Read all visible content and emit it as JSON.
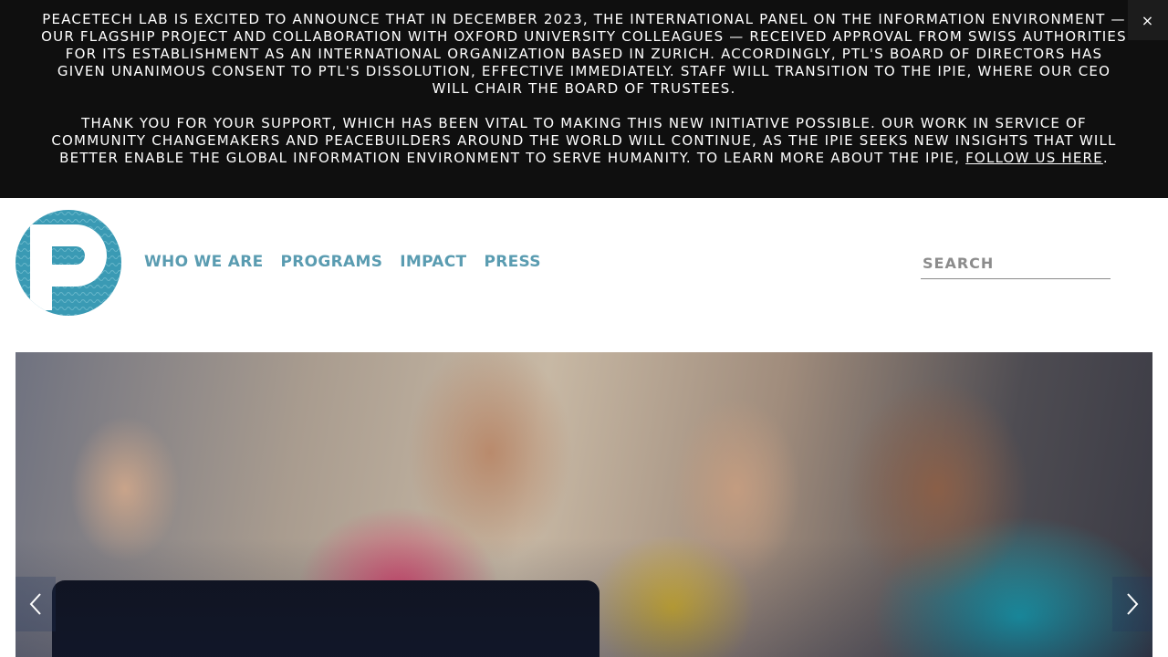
{
  "announcement": {
    "paragraph1": "PeaceTech Lab is excited to announce that in December 2023, the International Panel on the Information Environment — our flagship project and collaboration with Oxford University colleagues — received approval from Swiss authorities for its establishment as an international organization based in Zurich.  Accordingly, PTL's Board of Directors has given unanimous consent to PTL's dissolution, effective immediately. Staff will transition to the IPIE, where our CEO will chair the Board of Trustees.",
    "paragraph2": "Thank you for your support, which has been vital to making this new initiative possible. Our work in service of community changemakers and peacebuilders around the world will continue, as the IPIE seeks new insights that will better enable the global information environment to serve humanity. To learn more about the IPIE,",
    "link_label": "follow us here",
    "period": ".",
    "close_label": "×"
  },
  "logo": {
    "icon": "peacetech-p-logo",
    "color": "#3a9ab4"
  },
  "nav": {
    "items": [
      {
        "label": "WHO WE ARE"
      },
      {
        "label": "PROGRAMS"
      },
      {
        "label": "IMPACT"
      },
      {
        "label": "PRESS"
      }
    ],
    "color": "#5a9cb1"
  },
  "search": {
    "placeholder": "SEARCH",
    "value": ""
  },
  "hero": {
    "image": "children-looking-at-tablet-photo",
    "prev_icon": "chevron-left-icon",
    "next_icon": "chevron-right-icon"
  }
}
